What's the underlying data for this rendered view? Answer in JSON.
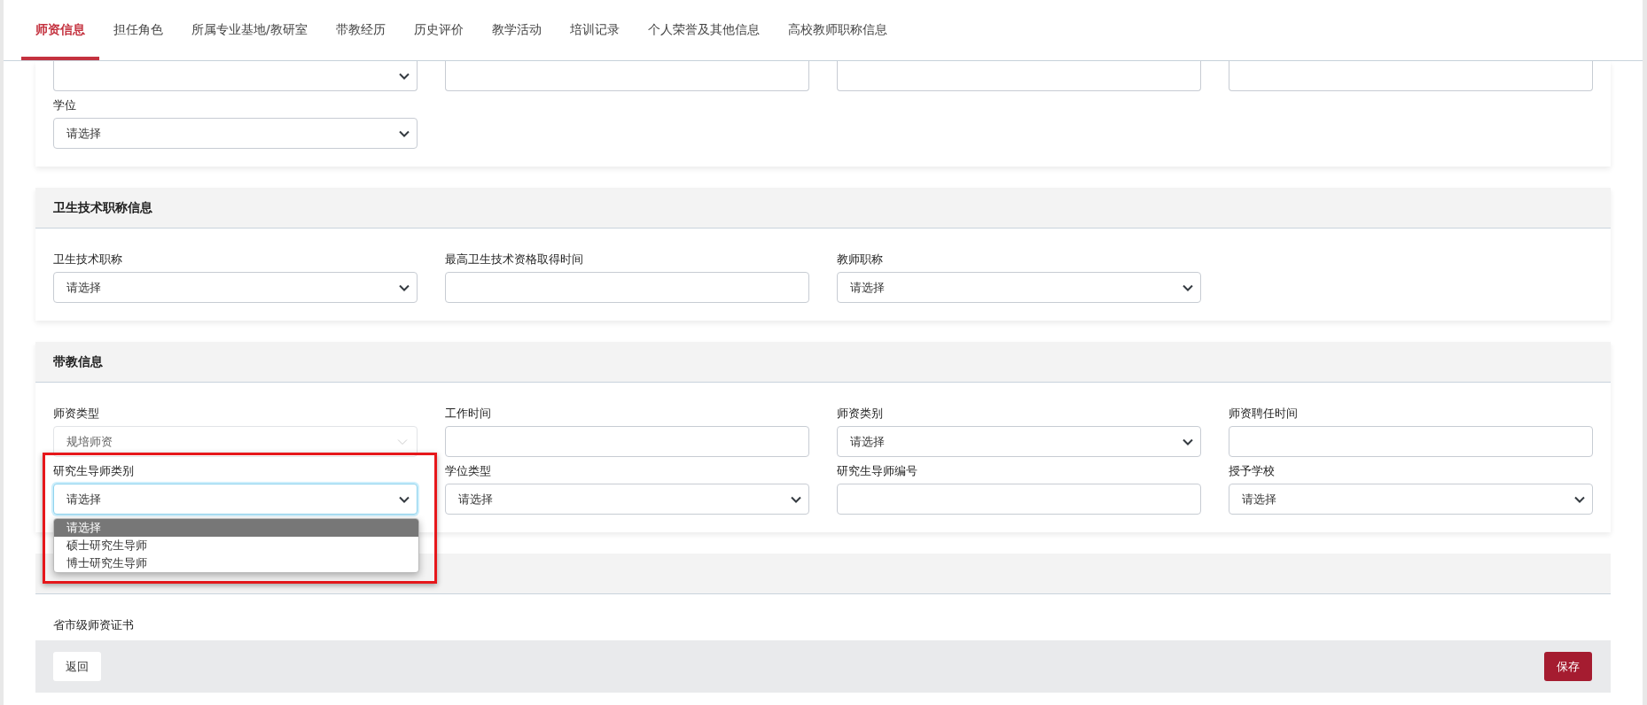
{
  "tabs": [
    {
      "label": "师资信息",
      "selected": true
    },
    {
      "label": "担任角色",
      "selected": false
    },
    {
      "label": "所属专业基地/教研室",
      "selected": false
    },
    {
      "label": "带教经历",
      "selected": false
    },
    {
      "label": "历史评价",
      "selected": false
    },
    {
      "label": "教学活动",
      "selected": false
    },
    {
      "label": "培训记录",
      "selected": false
    },
    {
      "label": "个人荣誉及其他信息",
      "selected": false
    },
    {
      "label": "高校教师职称信息",
      "selected": false
    }
  ],
  "sections": [
    {
      "partial_fields": [
        {
          "kind": "select"
        },
        {
          "kind": "input"
        },
        {
          "kind": "input"
        },
        {
          "kind": "input"
        }
      ],
      "fields": [
        {
          "label": "学位",
          "kind": "select",
          "value": "请选择"
        }
      ]
    },
    {
      "title": "卫生技术职称信息",
      "fields": [
        {
          "label": "卫生技术职称",
          "kind": "select",
          "value": "请选择"
        },
        {
          "label": "最高卫生技术资格取得时间",
          "kind": "input"
        },
        {
          "label": "教师职称",
          "kind": "select",
          "value": "请选择"
        }
      ]
    },
    {
      "title": "带教信息",
      "fields": [
        {
          "label": "师资类型",
          "kind": "select",
          "value": "规培师资",
          "disabled": true,
          "focused": false
        },
        {
          "label": "工作时间",
          "kind": "input",
          "disabled": false,
          "focused": false
        },
        {
          "label": "师资类别",
          "kind": "select",
          "value": "请选择",
          "disabled": false,
          "focused": false
        },
        {
          "label": "师资聘任时间",
          "kind": "input",
          "disabled": false,
          "focused": false
        },
        {
          "label": "研究生导师类别",
          "kind": "select",
          "value": "请选择",
          "disabled": false,
          "focused": true,
          "highlighted": true,
          "options": [
            {
              "label": "请选择",
              "selected": true
            },
            {
              "label": "硕士研究生导师",
              "selected": false
            },
            {
              "label": "博士研究生导师",
              "selected": false
            }
          ]
        },
        {
          "label": "学位类型",
          "kind": "select",
          "value": "请选择",
          "disabled": false,
          "focused": false
        },
        {
          "label": "研究生导师编号",
          "kind": "input",
          "disabled": false,
          "focused": false
        },
        {
          "label": "授予学校",
          "kind": "select",
          "value": "请选择",
          "disabled": false,
          "focused": false
        }
      ]
    },
    {
      "header": true,
      "fields": [
        {
          "label": "省市级师资证书",
          "kind": "text"
        }
      ]
    }
  ],
  "footer": {
    "back": "返回",
    "save": "保存"
  }
}
